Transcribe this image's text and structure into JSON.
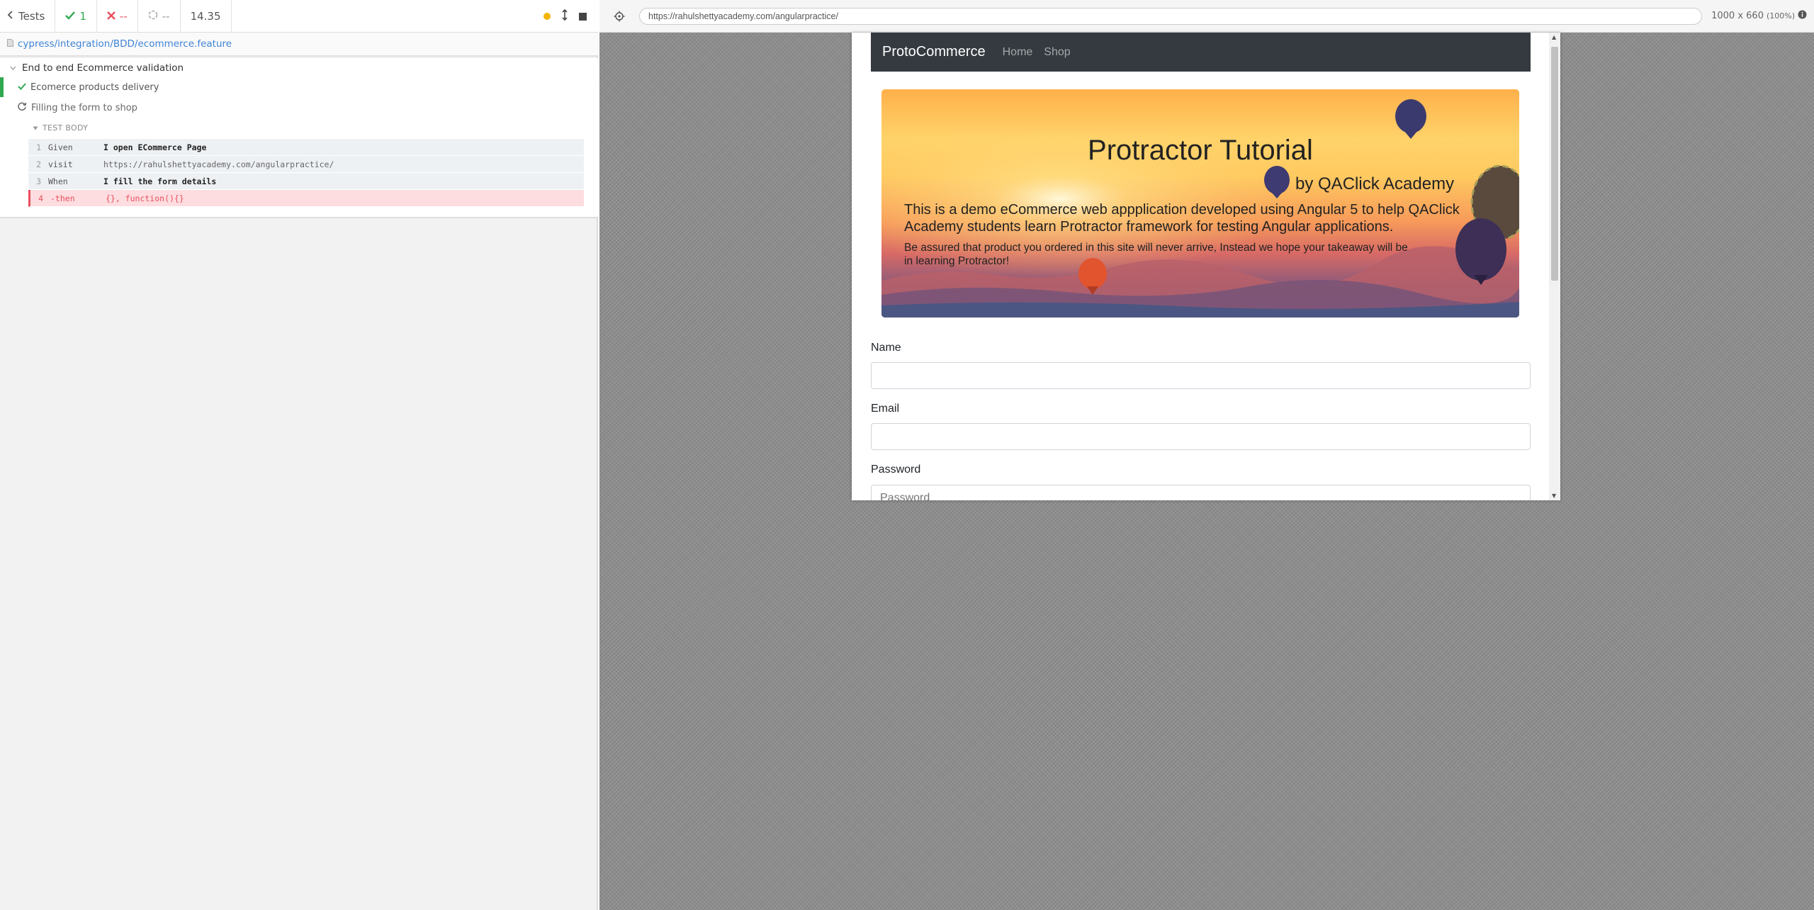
{
  "reporter": {
    "tests_label": "Tests",
    "passed_count": "1",
    "failed_count": "--",
    "pending_count": "--",
    "duration": "14.35",
    "spec_path": "cypress/integration/BDD/ecommerce.feature",
    "suite_title": "End to end Ecommerce validation",
    "test_passed_title": "Ecomerce products delivery",
    "test_running_title": "Filling the form to shop",
    "test_body_label": "TEST BODY",
    "commands": [
      {
        "num": "1",
        "name": "Given",
        "message": "I open ECommerce Page"
      },
      {
        "num": "2",
        "name": "visit",
        "message": "https://rahulshettyacademy.com/angularpractice/"
      },
      {
        "num": "3",
        "name": "When",
        "message": "I fill the form details"
      },
      {
        "num": "4",
        "name": "-then",
        "message": "{}, function(){}"
      }
    ]
  },
  "aut_header": {
    "url": "https://rahulshettyacademy.com/angularpractice/",
    "viewport": "1000 x 660",
    "zoom": "(100%)"
  },
  "site": {
    "brand": "ProtoCommerce",
    "nav_links": [
      "Home",
      "Shop"
    ],
    "jumbotron": {
      "title": "Protractor Tutorial",
      "subtitle": "by QAClick Academy",
      "lead": "This is a demo eCommerce web appplication developed using Angular 5 to help QAClick Academy students learn Protractor framework for testing Angular applications.",
      "note": "Be assured that product you ordered in this site will never arrive, Instead we hope your takeaway will be in learning Protractor!"
    },
    "form": {
      "name_label": "Name",
      "name_value": "",
      "email_label": "Email",
      "email_value": "",
      "password_label": "Password",
      "password_placeholder": "Password"
    }
  },
  "colors": {
    "passed": "#2fa84f",
    "failed": "#e94f5f",
    "link": "#3f83d6",
    "navbar": "#343a40"
  }
}
